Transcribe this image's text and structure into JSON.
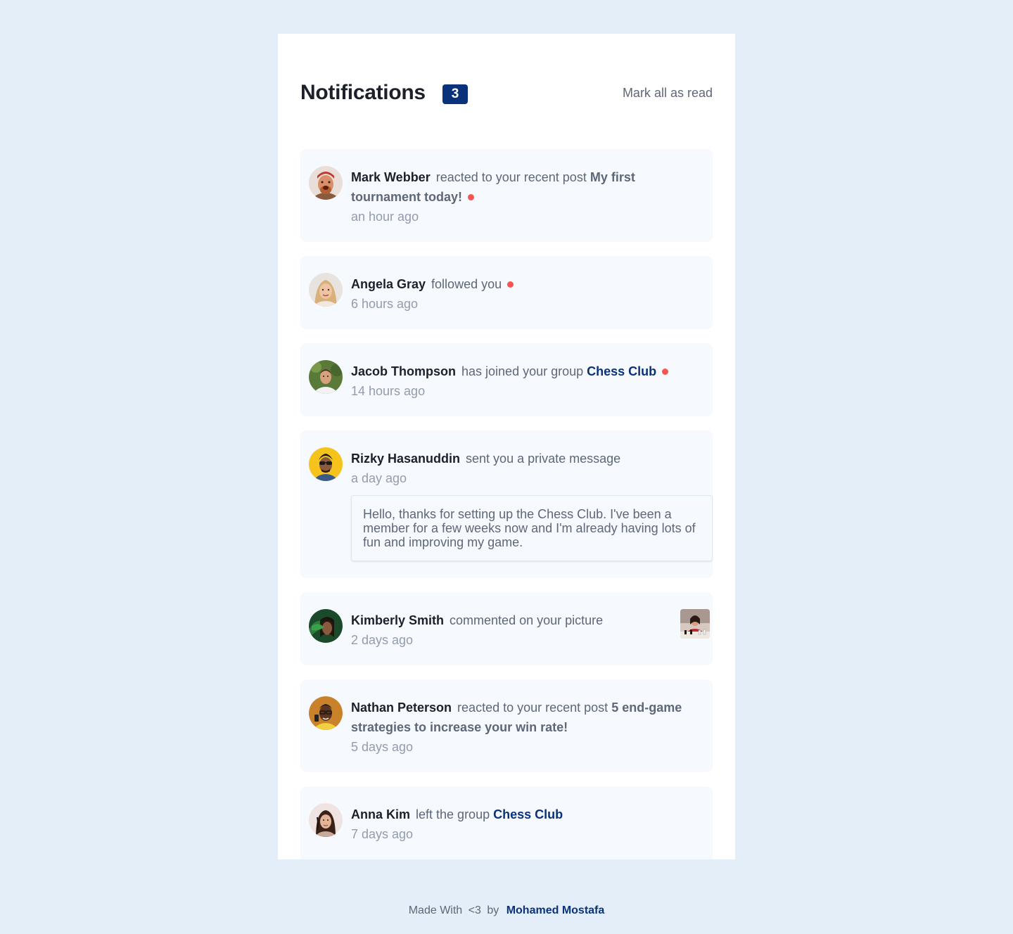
{
  "header": {
    "title": "Notifications",
    "unread_count": "3",
    "mark_all_label": "Mark all as read"
  },
  "notifications": [
    {
      "name": "Mark Webber",
      "action": "reacted to your recent post",
      "target": "My first tournament today!",
      "time": "an hour ago",
      "unread": true,
      "avatar_icon": "avatar-mark-webber"
    },
    {
      "name": "Angela Gray",
      "action": "followed you",
      "time": "6 hours ago",
      "unread": true,
      "avatar_icon": "avatar-angela-gray"
    },
    {
      "name": "Jacob Thompson",
      "action": "has joined your group",
      "group": "Chess Club",
      "time": "14 hours ago",
      "unread": true,
      "avatar_icon": "avatar-jacob-thompson"
    },
    {
      "name": "Rizky Hasanuddin",
      "action": "sent you a private message",
      "time": "a day ago",
      "unread": false,
      "message": "Hello, thanks for setting up the Chess Club. I've been a member for a few weeks now and I'm already having lots of fun and improving my game.",
      "avatar_icon": "avatar-rizky-hasanuddin"
    },
    {
      "name": "Kimberly Smith",
      "action": "commented on your picture",
      "time": "2 days ago",
      "unread": false,
      "thumbnail_icon": "chess-picture-thumbnail",
      "avatar_icon": "avatar-kimberly-smith"
    },
    {
      "name": "Nathan Peterson",
      "action": "reacted to your recent post",
      "target": "5 end-game strategies to increase your win rate!",
      "time": "5 days ago",
      "unread": false,
      "avatar_icon": "avatar-nathan-peterson"
    },
    {
      "name": "Anna Kim",
      "action": "left the group",
      "group": "Chess Club",
      "time": "7 days ago",
      "unread": false,
      "avatar_icon": "avatar-anna-kim"
    }
  ],
  "footer": {
    "made_with": "Made With",
    "heart": "<3",
    "by": "by",
    "author": "Mohamed Mostafa"
  },
  "colors": {
    "page_background": "#e4eef8",
    "card_background": "#ffffff",
    "item_background": "#f6f9fd",
    "badge": "#0a327b",
    "unread_dot": "#f65552",
    "group_link": "#0a327b",
    "text_dark": "#1c202b",
    "text_muted": "#5e6778",
    "text_time": "#939cad"
  }
}
